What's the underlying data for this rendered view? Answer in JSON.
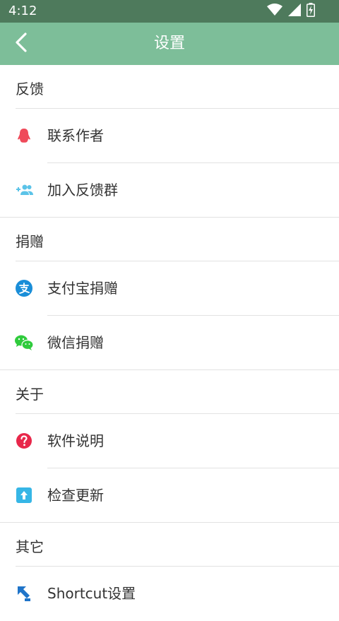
{
  "status_bar": {
    "time": "4:12",
    "icons": [
      "wifi-icon",
      "signal-icon",
      "battery-charging-icon"
    ]
  },
  "app_bar": {
    "title": "设置",
    "back_icon": "back-arrow-icon"
  },
  "sections": [
    {
      "header": "反馈",
      "items": [
        {
          "label": "联系作者",
          "icon": "qq-penguin-icon",
          "color": "#ef4a5a"
        },
        {
          "label": "加入反馈群",
          "icon": "group-add-icon",
          "color": "#5bc3e8"
        }
      ]
    },
    {
      "header": "捐赠",
      "items": [
        {
          "label": "支付宝捐赠",
          "icon": "alipay-icon",
          "color": "#1a8ed8"
        },
        {
          "label": "微信捐赠",
          "icon": "wechat-icon",
          "color": "#2fcb3c"
        }
      ]
    },
    {
      "header": "关于",
      "items": [
        {
          "label": "软件说明",
          "icon": "help-icon",
          "color": "#e8274a"
        },
        {
          "label": "检查更新",
          "icon": "update-icon",
          "color": "#36b6e6"
        }
      ]
    },
    {
      "header": "其它",
      "items": [
        {
          "label": "Shortcut设置",
          "icon": "shortcut-arrow-icon",
          "color": "#1f74c9"
        }
      ]
    }
  ],
  "colors": {
    "status_bar_bg": "#4e7a5c",
    "app_bar_bg": "#7dbe99",
    "text": "#333333",
    "divider": "#e2e2e2"
  }
}
